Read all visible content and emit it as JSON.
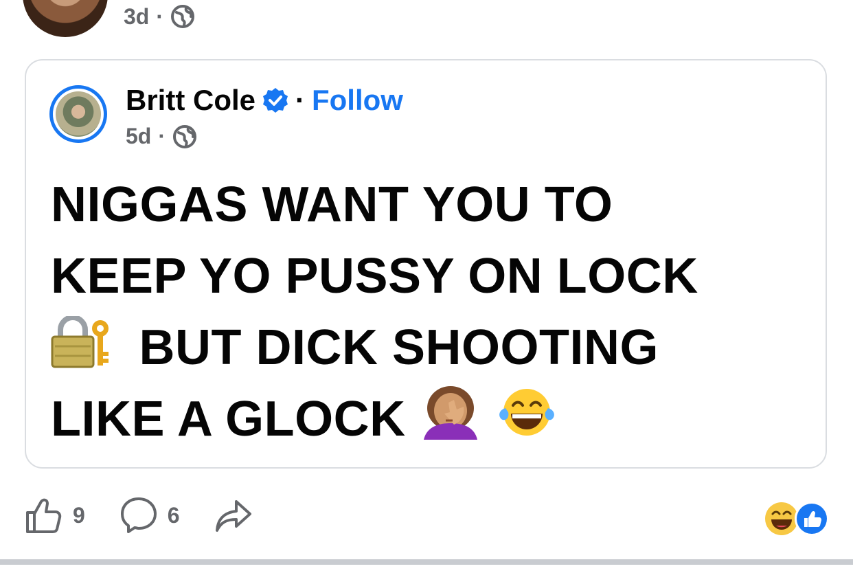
{
  "top_post": {
    "time": "3d",
    "separator": "·",
    "privacy_icon": "globe-icon"
  },
  "shared_post": {
    "author": "Britt Cole",
    "verified_icon": "verified-badge-icon",
    "separator": "·",
    "follow_label": "Follow",
    "time": "5d",
    "privacy_icon": "globe-icon",
    "text_lines": [
      "NIGGAS WANT YOU TO",
      "KEEP YO PUSSY ON LOCK",
      "BUT DICK SHOOTING",
      "LIKE A GLOCK"
    ],
    "emojis": [
      "lock-with-key-emoji",
      "face-palm-emoji",
      "tears-of-joy-emoji"
    ]
  },
  "actions": {
    "like_count": "9",
    "comment_count": "6",
    "share_icon": "share-arrow-icon"
  },
  "reactions": [
    "laughing-reaction-icon",
    "like-reaction-icon"
  ],
  "colors": {
    "accent": "#1877f2",
    "secondary_text": "#65676b",
    "border": "#dadde1"
  }
}
